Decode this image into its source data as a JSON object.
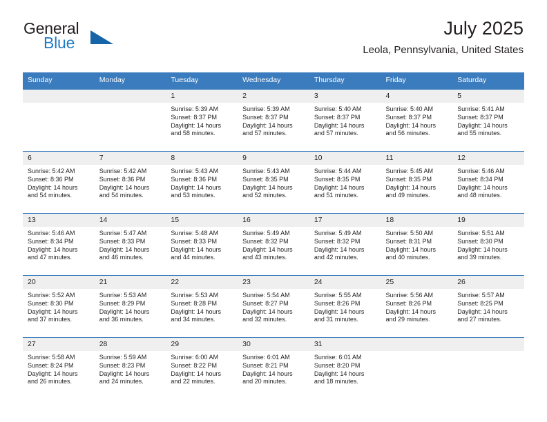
{
  "brand": {
    "name_primary": "General",
    "name_secondary": "Blue",
    "triangle_color": "#1565a8",
    "blue_color": "#1f7ac4"
  },
  "header": {
    "title": "July 2025",
    "subtitle": "Leola, Pennsylvania, United States"
  },
  "theme": {
    "header_blue": "#3b7cbe",
    "daynum_band": "#efefef",
    "text": "#231f20"
  },
  "weekdays": [
    "Sunday",
    "Monday",
    "Tuesday",
    "Wednesday",
    "Thursday",
    "Friday",
    "Saturday"
  ],
  "labels": {
    "sunrise_prefix": "Sunrise: ",
    "sunset_prefix": "Sunset: ",
    "daylight_prefix": "Daylight: "
  },
  "weeks": [
    [
      {
        "day": "",
        "sunrise": "",
        "sunset": "",
        "daylight_line1": "",
        "daylight_line2": ""
      },
      {
        "day": "",
        "sunrise": "",
        "sunset": "",
        "daylight_line1": "",
        "daylight_line2": ""
      },
      {
        "day": "1",
        "sunrise": "Sunrise: 5:39 AM",
        "sunset": "Sunset: 8:37 PM",
        "daylight_line1": "Daylight: 14 hours",
        "daylight_line2": "and 58 minutes."
      },
      {
        "day": "2",
        "sunrise": "Sunrise: 5:39 AM",
        "sunset": "Sunset: 8:37 PM",
        "daylight_line1": "Daylight: 14 hours",
        "daylight_line2": "and 57 minutes."
      },
      {
        "day": "3",
        "sunrise": "Sunrise: 5:40 AM",
        "sunset": "Sunset: 8:37 PM",
        "daylight_line1": "Daylight: 14 hours",
        "daylight_line2": "and 57 minutes."
      },
      {
        "day": "4",
        "sunrise": "Sunrise: 5:40 AM",
        "sunset": "Sunset: 8:37 PM",
        "daylight_line1": "Daylight: 14 hours",
        "daylight_line2": "and 56 minutes."
      },
      {
        "day": "5",
        "sunrise": "Sunrise: 5:41 AM",
        "sunset": "Sunset: 8:37 PM",
        "daylight_line1": "Daylight: 14 hours",
        "daylight_line2": "and 55 minutes."
      }
    ],
    [
      {
        "day": "6",
        "sunrise": "Sunrise: 5:42 AM",
        "sunset": "Sunset: 8:36 PM",
        "daylight_line1": "Daylight: 14 hours",
        "daylight_line2": "and 54 minutes."
      },
      {
        "day": "7",
        "sunrise": "Sunrise: 5:42 AM",
        "sunset": "Sunset: 8:36 PM",
        "daylight_line1": "Daylight: 14 hours",
        "daylight_line2": "and 54 minutes."
      },
      {
        "day": "8",
        "sunrise": "Sunrise: 5:43 AM",
        "sunset": "Sunset: 8:36 PM",
        "daylight_line1": "Daylight: 14 hours",
        "daylight_line2": "and 53 minutes."
      },
      {
        "day": "9",
        "sunrise": "Sunrise: 5:43 AM",
        "sunset": "Sunset: 8:35 PM",
        "daylight_line1": "Daylight: 14 hours",
        "daylight_line2": "and 52 minutes."
      },
      {
        "day": "10",
        "sunrise": "Sunrise: 5:44 AM",
        "sunset": "Sunset: 8:35 PM",
        "daylight_line1": "Daylight: 14 hours",
        "daylight_line2": "and 51 minutes."
      },
      {
        "day": "11",
        "sunrise": "Sunrise: 5:45 AM",
        "sunset": "Sunset: 8:35 PM",
        "daylight_line1": "Daylight: 14 hours",
        "daylight_line2": "and 49 minutes."
      },
      {
        "day": "12",
        "sunrise": "Sunrise: 5:46 AM",
        "sunset": "Sunset: 8:34 PM",
        "daylight_line1": "Daylight: 14 hours",
        "daylight_line2": "and 48 minutes."
      }
    ],
    [
      {
        "day": "13",
        "sunrise": "Sunrise: 5:46 AM",
        "sunset": "Sunset: 8:34 PM",
        "daylight_line1": "Daylight: 14 hours",
        "daylight_line2": "and 47 minutes."
      },
      {
        "day": "14",
        "sunrise": "Sunrise: 5:47 AM",
        "sunset": "Sunset: 8:33 PM",
        "daylight_line1": "Daylight: 14 hours",
        "daylight_line2": "and 46 minutes."
      },
      {
        "day": "15",
        "sunrise": "Sunrise: 5:48 AM",
        "sunset": "Sunset: 8:33 PM",
        "daylight_line1": "Daylight: 14 hours",
        "daylight_line2": "and 44 minutes."
      },
      {
        "day": "16",
        "sunrise": "Sunrise: 5:49 AM",
        "sunset": "Sunset: 8:32 PM",
        "daylight_line1": "Daylight: 14 hours",
        "daylight_line2": "and 43 minutes."
      },
      {
        "day": "17",
        "sunrise": "Sunrise: 5:49 AM",
        "sunset": "Sunset: 8:32 PM",
        "daylight_line1": "Daylight: 14 hours",
        "daylight_line2": "and 42 minutes."
      },
      {
        "day": "18",
        "sunrise": "Sunrise: 5:50 AM",
        "sunset": "Sunset: 8:31 PM",
        "daylight_line1": "Daylight: 14 hours",
        "daylight_line2": "and 40 minutes."
      },
      {
        "day": "19",
        "sunrise": "Sunrise: 5:51 AM",
        "sunset": "Sunset: 8:30 PM",
        "daylight_line1": "Daylight: 14 hours",
        "daylight_line2": "and 39 minutes."
      }
    ],
    [
      {
        "day": "20",
        "sunrise": "Sunrise: 5:52 AM",
        "sunset": "Sunset: 8:30 PM",
        "daylight_line1": "Daylight: 14 hours",
        "daylight_line2": "and 37 minutes."
      },
      {
        "day": "21",
        "sunrise": "Sunrise: 5:53 AM",
        "sunset": "Sunset: 8:29 PM",
        "daylight_line1": "Daylight: 14 hours",
        "daylight_line2": "and 36 minutes."
      },
      {
        "day": "22",
        "sunrise": "Sunrise: 5:53 AM",
        "sunset": "Sunset: 8:28 PM",
        "daylight_line1": "Daylight: 14 hours",
        "daylight_line2": "and 34 minutes."
      },
      {
        "day": "23",
        "sunrise": "Sunrise: 5:54 AM",
        "sunset": "Sunset: 8:27 PM",
        "daylight_line1": "Daylight: 14 hours",
        "daylight_line2": "and 32 minutes."
      },
      {
        "day": "24",
        "sunrise": "Sunrise: 5:55 AM",
        "sunset": "Sunset: 8:26 PM",
        "daylight_line1": "Daylight: 14 hours",
        "daylight_line2": "and 31 minutes."
      },
      {
        "day": "25",
        "sunrise": "Sunrise: 5:56 AM",
        "sunset": "Sunset: 8:26 PM",
        "daylight_line1": "Daylight: 14 hours",
        "daylight_line2": "and 29 minutes."
      },
      {
        "day": "26",
        "sunrise": "Sunrise: 5:57 AM",
        "sunset": "Sunset: 8:25 PM",
        "daylight_line1": "Daylight: 14 hours",
        "daylight_line2": "and 27 minutes."
      }
    ],
    [
      {
        "day": "27",
        "sunrise": "Sunrise: 5:58 AM",
        "sunset": "Sunset: 8:24 PM",
        "daylight_line1": "Daylight: 14 hours",
        "daylight_line2": "and 26 minutes."
      },
      {
        "day": "28",
        "sunrise": "Sunrise: 5:59 AM",
        "sunset": "Sunset: 8:23 PM",
        "daylight_line1": "Daylight: 14 hours",
        "daylight_line2": "and 24 minutes."
      },
      {
        "day": "29",
        "sunrise": "Sunrise: 6:00 AM",
        "sunset": "Sunset: 8:22 PM",
        "daylight_line1": "Daylight: 14 hours",
        "daylight_line2": "and 22 minutes."
      },
      {
        "day": "30",
        "sunrise": "Sunrise: 6:01 AM",
        "sunset": "Sunset: 8:21 PM",
        "daylight_line1": "Daylight: 14 hours",
        "daylight_line2": "and 20 minutes."
      },
      {
        "day": "31",
        "sunrise": "Sunrise: 6:01 AM",
        "sunset": "Sunset: 8:20 PM",
        "daylight_line1": "Daylight: 14 hours",
        "daylight_line2": "and 18 minutes."
      },
      {
        "day": "",
        "sunrise": "",
        "sunset": "",
        "daylight_line1": "",
        "daylight_line2": ""
      },
      {
        "day": "",
        "sunrise": "",
        "sunset": "",
        "daylight_line1": "",
        "daylight_line2": ""
      }
    ]
  ]
}
